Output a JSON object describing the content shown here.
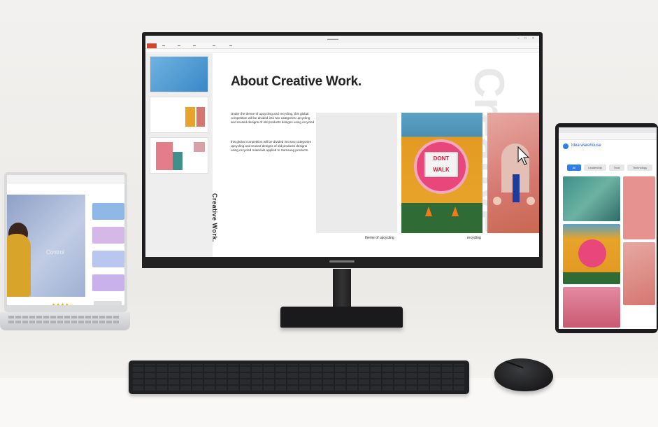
{
  "monitor": {
    "slide_title": "About Creative Work.",
    "body_paragraph_1": "Under the theme of upcycling and recycling, this global competition will be divided into two categories upcycling and reused designs of old products designs using recycled",
    "body_paragraph_2": "this global competition will be divided into two categories upcycling and reused designs of old products designs using recycled materials applied to Samsung products.",
    "vertical_label": "Creative Work.",
    "ghost_text": "Creative",
    "sign_text": "DONT WALK",
    "caption_left": "theme of upcycling",
    "caption_right": "recycling"
  },
  "laptop": {
    "video_word": "Control",
    "rating": "★★★★☆"
  },
  "tablet": {
    "site_title": "Idea warehouse",
    "chips": [
      "All",
      "Leadership",
      "Trust",
      "Technology"
    ]
  },
  "colors": {
    "accent_red": "#d1472b",
    "accent_blue": "#2d7ee6"
  }
}
